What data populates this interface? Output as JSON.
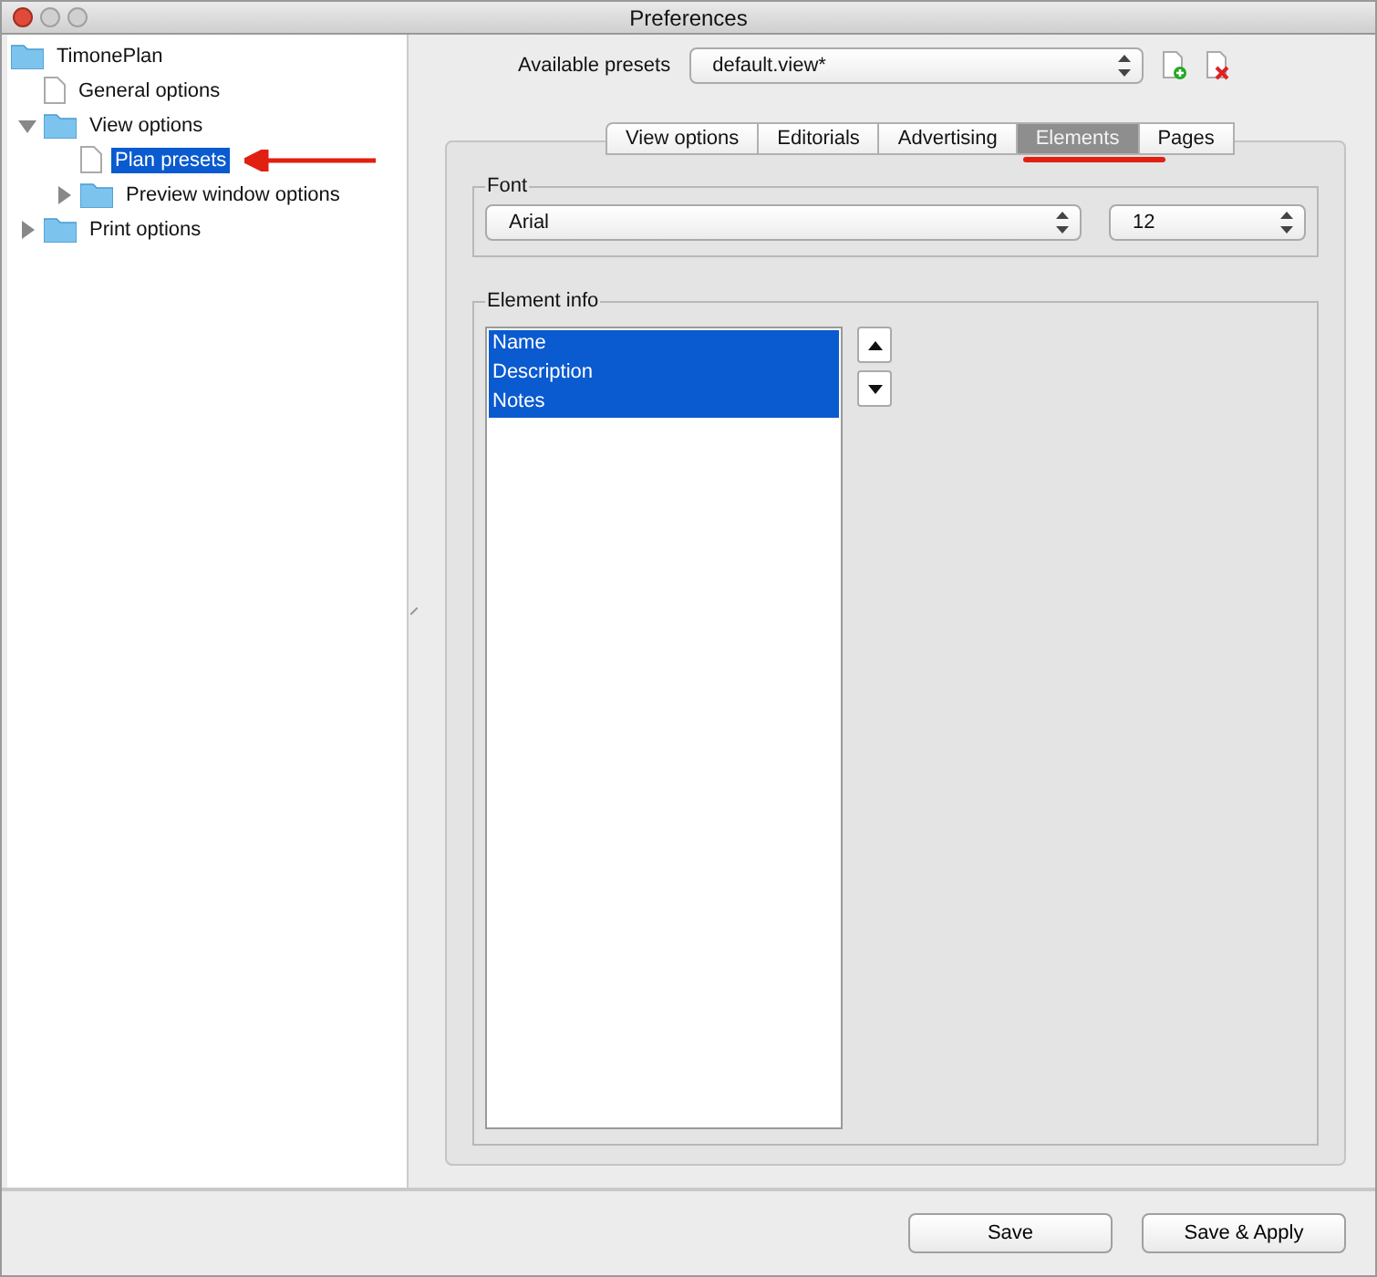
{
  "window": {
    "title": "Preferences"
  },
  "tree": [
    {
      "label": "TimonePlan",
      "kind": "folder",
      "selected": false,
      "children": [
        {
          "label": "General options",
          "kind": "page",
          "selected": false
        },
        {
          "label": "View options",
          "kind": "folder",
          "expanded": true,
          "selected": false,
          "children": [
            {
              "label": "Plan presets",
              "kind": "page",
              "selected": true
            },
            {
              "label": "Preview window options",
              "kind": "folder",
              "expanded": false,
              "selected": false
            }
          ]
        },
        {
          "label": "Print options",
          "kind": "folder",
          "expanded": false,
          "selected": false
        }
      ]
    }
  ],
  "presets": {
    "label": "Available presets",
    "value": "default.view*"
  },
  "tabs": [
    {
      "label": "View options",
      "selected": false
    },
    {
      "label": "Editorials",
      "selected": false
    },
    {
      "label": "Advertising",
      "selected": false
    },
    {
      "label": "Elements",
      "selected": true
    },
    {
      "label": "Pages",
      "selected": false
    }
  ],
  "font": {
    "title": "Font",
    "family": "Arial",
    "size": "12"
  },
  "element_info": {
    "title": "Element info",
    "items": [
      {
        "label": "Name",
        "selected": true
      },
      {
        "label": "Description",
        "selected": true
      },
      {
        "label": "Notes",
        "selected": true
      }
    ]
  },
  "buttons": [
    "Save",
    "Save & Apply"
  ]
}
